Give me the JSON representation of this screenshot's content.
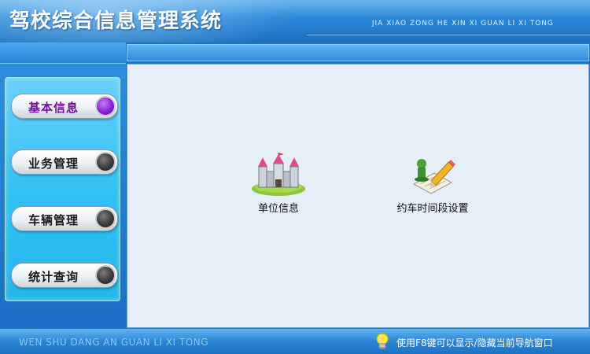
{
  "header": {
    "title": "驾校综合信息管理系统",
    "subtitle": "JIA XIAO ZONG HE XIN XI GUAN LI XI TONG"
  },
  "nav": {
    "items": [
      {
        "label": "基本信息",
        "active": true
      },
      {
        "label": "业务管理",
        "active": false
      },
      {
        "label": "车辆管理",
        "active": false
      },
      {
        "label": "统计查询",
        "active": false
      }
    ]
  },
  "main": {
    "tiles": [
      {
        "label": "单位信息",
        "icon": "castle-icon"
      },
      {
        "label": "约车时间段设置",
        "icon": "notepad-pencil-icon"
      }
    ]
  },
  "footer": {
    "left_text": "WEN SHU DANG AN GUAN LI XI TONG",
    "hint": "使用F8键可以显示/隐藏当前导航窗口",
    "hint_icon": "lightbulb-icon"
  },
  "colors": {
    "header_blue": "#2b86d6",
    "nav_panel": "#32c2f3",
    "active_label": "#7a0aa3",
    "content_bg": "#e6eef8"
  }
}
